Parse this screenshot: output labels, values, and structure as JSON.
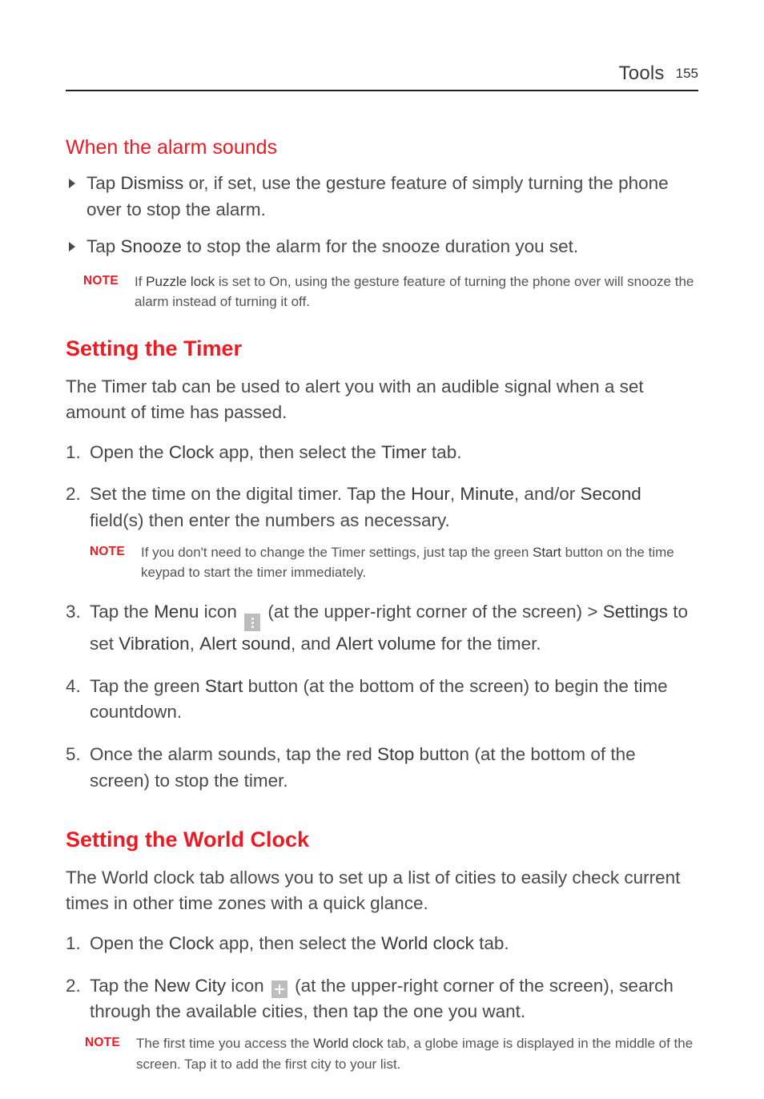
{
  "header": {
    "section": "Tools",
    "page": "155"
  },
  "subhead1": "When the alarm sounds",
  "bul1_a": "Tap ",
  "bul1_b": "Dismiss",
  "bul1_c": " or, if set, use the gesture feature of simply turning the phone over to stop the alarm.",
  "bul2_a": "Tap ",
  "bul2_b": "Snooze",
  "bul2_c": " to stop the alarm for the snooze duration you set.",
  "note_label": "NOTE",
  "note1_a": "If ",
  "note1_b": "Puzzle lock",
  "note1_c": " is set to On, using the gesture feature of turning the phone over will snooze the alarm instead of turning it off.",
  "h2_timer": "Setting the Timer",
  "timer_intro": "The Timer tab can be used to alert you with an audible signal when a set amount of time has passed.",
  "t1_a": "Open the ",
  "t1_b": "Clock",
  "t1_c": " app, then select the ",
  "t1_d": "Timer",
  "t1_e": " tab.",
  "t2_a": "Set the time on the digital timer. Tap the ",
  "t2_b": "Hour",
  "t2_c": ", ",
  "t2_d": "Minute",
  "t2_e": ", and/or ",
  "t2_f": "Second",
  "t2_g": " field(s) then enter the numbers as necessary.",
  "note2_a": "If you don't need to change the Timer settings, just tap the green ",
  "note2_b": "Start",
  "note2_c": " button on the time keypad to start the timer immediately.",
  "t3_a": "Tap the ",
  "t3_b": "Menu",
  "t3_c": " icon ",
  "t3_d": " (at the upper-right corner of the screen) > ",
  "t3_e": "Settings",
  "t3_f": " to set ",
  "t3_g": "Vibration",
  "t3_h": ", ",
  "t3_i": "Alert sound",
  "t3_j": ", and ",
  "t3_k": "Alert volume",
  "t3_l": " for the timer.",
  "t4_a": "Tap the green ",
  "t4_b": "Start",
  "t4_c": " button (at the bottom of the screen) to begin the time countdown.",
  "t5_a": "Once the alarm sounds, tap the red ",
  "t5_b": "Stop",
  "t5_c": " button (at the bottom of the screen) to stop the timer.",
  "h2_world": "Setting the World Clock",
  "world_intro": "The World clock tab allows you to set up a list of cities to easily check current times in other time zones with a quick glance.",
  "w1_a": "Open the ",
  "w1_b": "Clock",
  "w1_c": " app, then select the ",
  "w1_d": "World clock",
  "w1_e": " tab.",
  "w2_a": "Tap the ",
  "w2_b": "New City",
  "w2_c": " icon ",
  "w2_d": " (at the upper-right corner of the screen), search through the available cities, then tap the one you want.",
  "note3_a": "The first time you access the ",
  "note3_b": "World clock",
  "note3_c": " tab, a globe image is displayed in the middle of the screen. Tap it to add the first city to your list."
}
